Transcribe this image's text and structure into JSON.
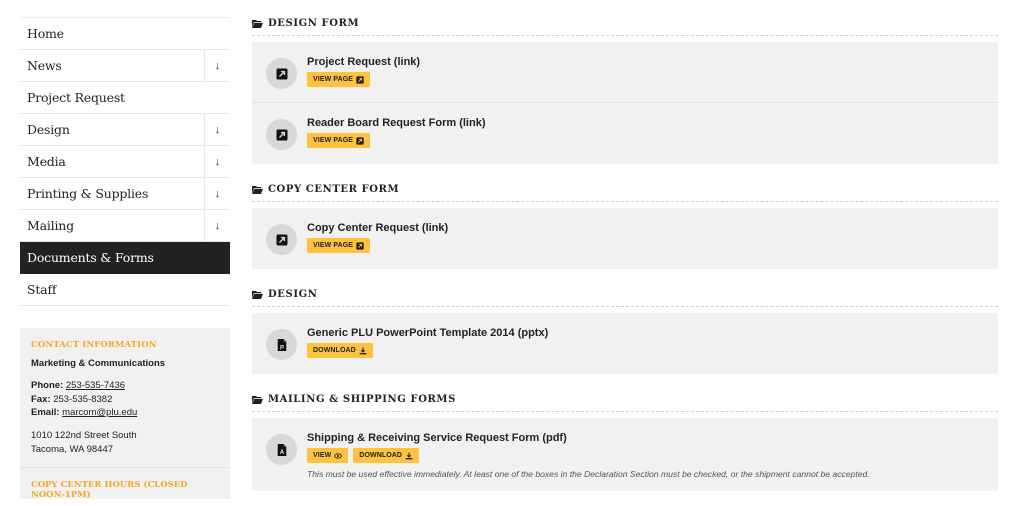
{
  "sidebar": {
    "nav": [
      {
        "label": "Home",
        "has_toggle": false,
        "active": false
      },
      {
        "label": "News",
        "has_toggle": true,
        "active": false
      },
      {
        "label": "Project Request",
        "has_toggle": false,
        "active": false
      },
      {
        "label": "Design",
        "has_toggle": true,
        "active": false
      },
      {
        "label": "Media",
        "has_toggle": true,
        "active": false
      },
      {
        "label": "Printing & Supplies",
        "has_toggle": true,
        "active": false
      },
      {
        "label": "Mailing",
        "has_toggle": true,
        "active": false
      },
      {
        "label": "Documents & Forms",
        "has_toggle": false,
        "active": true
      },
      {
        "label": "Staff",
        "has_toggle": false,
        "active": false
      }
    ],
    "toggle_glyph": "↓",
    "contact": {
      "heading": "CONTACT INFORMATION",
      "org": "Marketing & Communications",
      "phone_label": "Phone:",
      "phone": "253-535-7436",
      "fax_label": "Fax:",
      "fax": "253-535-8382",
      "email_label": "Email:",
      "email": "marcom@plu.edu",
      "address_line1": "1010 122nd Street South",
      "address_line2": "Tacoma, WA 98447"
    },
    "hours_heading": "COPY CENTER HOURS (CLOSED NOON-1PM)"
  },
  "colors": {
    "accent": "#fdc23e",
    "heading_orange": "#f5a623",
    "active_bg": "#222222",
    "card_bg": "#f1f1f1"
  },
  "main": {
    "sections": [
      {
        "heading": "DESIGN FORM",
        "items": [
          {
            "title": "Project Request (link)",
            "icon": "external-link-icon",
            "buttons": [
              {
                "label": "VIEW PAGE",
                "icon": "external-link-icon"
              }
            ]
          },
          {
            "title": "Reader Board Request Form (link)",
            "icon": "external-link-icon",
            "buttons": [
              {
                "label": "VIEW PAGE",
                "icon": "external-link-icon"
              }
            ]
          }
        ]
      },
      {
        "heading": "COPY CENTER FORM",
        "items": [
          {
            "title": "Copy Center Request (link)",
            "icon": "external-link-icon",
            "buttons": [
              {
                "label": "VIEW PAGE",
                "icon": "external-link-icon"
              }
            ]
          }
        ]
      },
      {
        "heading": "DESIGN",
        "items": [
          {
            "title": "Generic PLU PowerPoint Template 2014 (pptx)",
            "icon": "powerpoint-file-icon",
            "buttons": [
              {
                "label": "DOWNLOAD",
                "icon": "download-icon"
              }
            ]
          }
        ]
      },
      {
        "heading": "MAILING & SHIPPING FORMS",
        "items": [
          {
            "title": "Shipping & Receiving Service Request Form (pdf)",
            "icon": "pdf-file-icon",
            "buttons": [
              {
                "label": "VIEW",
                "icon": "eye-icon"
              },
              {
                "label": "DOWNLOAD",
                "icon": "download-icon"
              }
            ],
            "note": "This must be used effective immediately. At least one of the boxes in the Declaration Section must be checked, or the shipment cannot be accepted."
          }
        ]
      }
    ]
  }
}
